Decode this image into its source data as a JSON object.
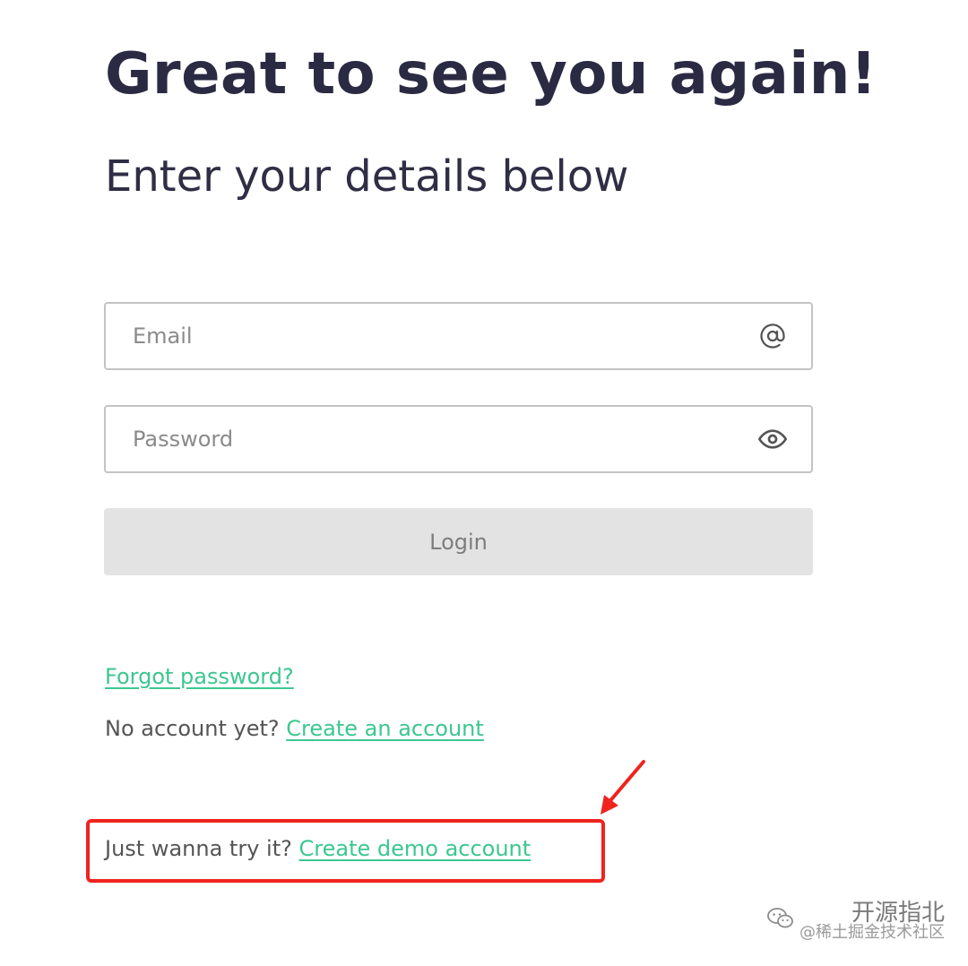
{
  "header": {
    "title": "Great to see you again!",
    "subtitle": "Enter your details below"
  },
  "form": {
    "email": {
      "placeholder": "Email",
      "value": "",
      "icon": "at-sign-icon"
    },
    "password": {
      "placeholder": "Password",
      "value": "",
      "icon": "eye-icon"
    },
    "login_label": "Login"
  },
  "links": {
    "forgot_password": "Forgot password?",
    "no_account_prefix": "No account yet?",
    "create_account": "Create an account",
    "demo_prefix": "Just wanna try it?",
    "create_demo": "Create demo account"
  },
  "annotation": {
    "highlight_color": "#f0231e"
  },
  "watermark": {
    "brand": "开源指北",
    "handle": "@稀土掘金技术社区"
  },
  "colors": {
    "link": "#3cc78f",
    "text": "#2b2a43",
    "button_bg": "#e3e3e3"
  }
}
